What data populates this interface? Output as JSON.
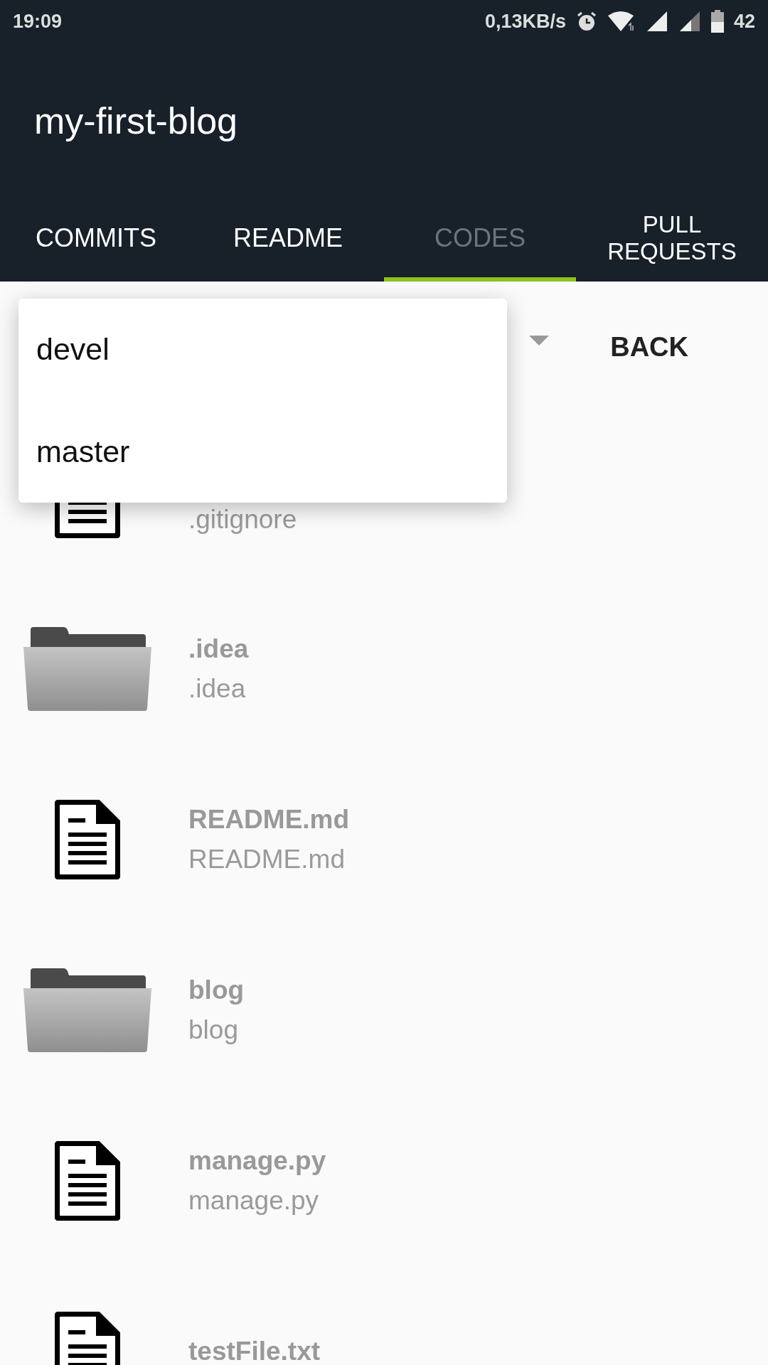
{
  "status_bar": {
    "time": "19:09",
    "speed": "0,13KB/s",
    "battery": "42"
  },
  "app_bar": {
    "title": "my-first-blog"
  },
  "tabs": [
    {
      "label": "COMMITS",
      "selected": false
    },
    {
      "label": "README",
      "selected": false
    },
    {
      "label": "CODES",
      "selected": true
    },
    {
      "label": "PULL REQUESTS",
      "selected": false
    }
  ],
  "branch_bar": {
    "back": "BACK"
  },
  "branch_menu": {
    "items": [
      {
        "label": "devel"
      },
      {
        "label": "master"
      }
    ]
  },
  "files": [
    {
      "kind": "file",
      "subtitle": ".gitignore"
    },
    {
      "kind": "folder",
      "title": ".idea",
      "subtitle": ".idea"
    },
    {
      "kind": "file",
      "title": "README.md",
      "subtitle": "README.md"
    },
    {
      "kind": "folder",
      "title": "blog",
      "subtitle": "blog"
    },
    {
      "kind": "file",
      "title": "manage.py",
      "subtitle": "manage.py"
    },
    {
      "kind": "file",
      "title": "testFile.txt"
    }
  ]
}
